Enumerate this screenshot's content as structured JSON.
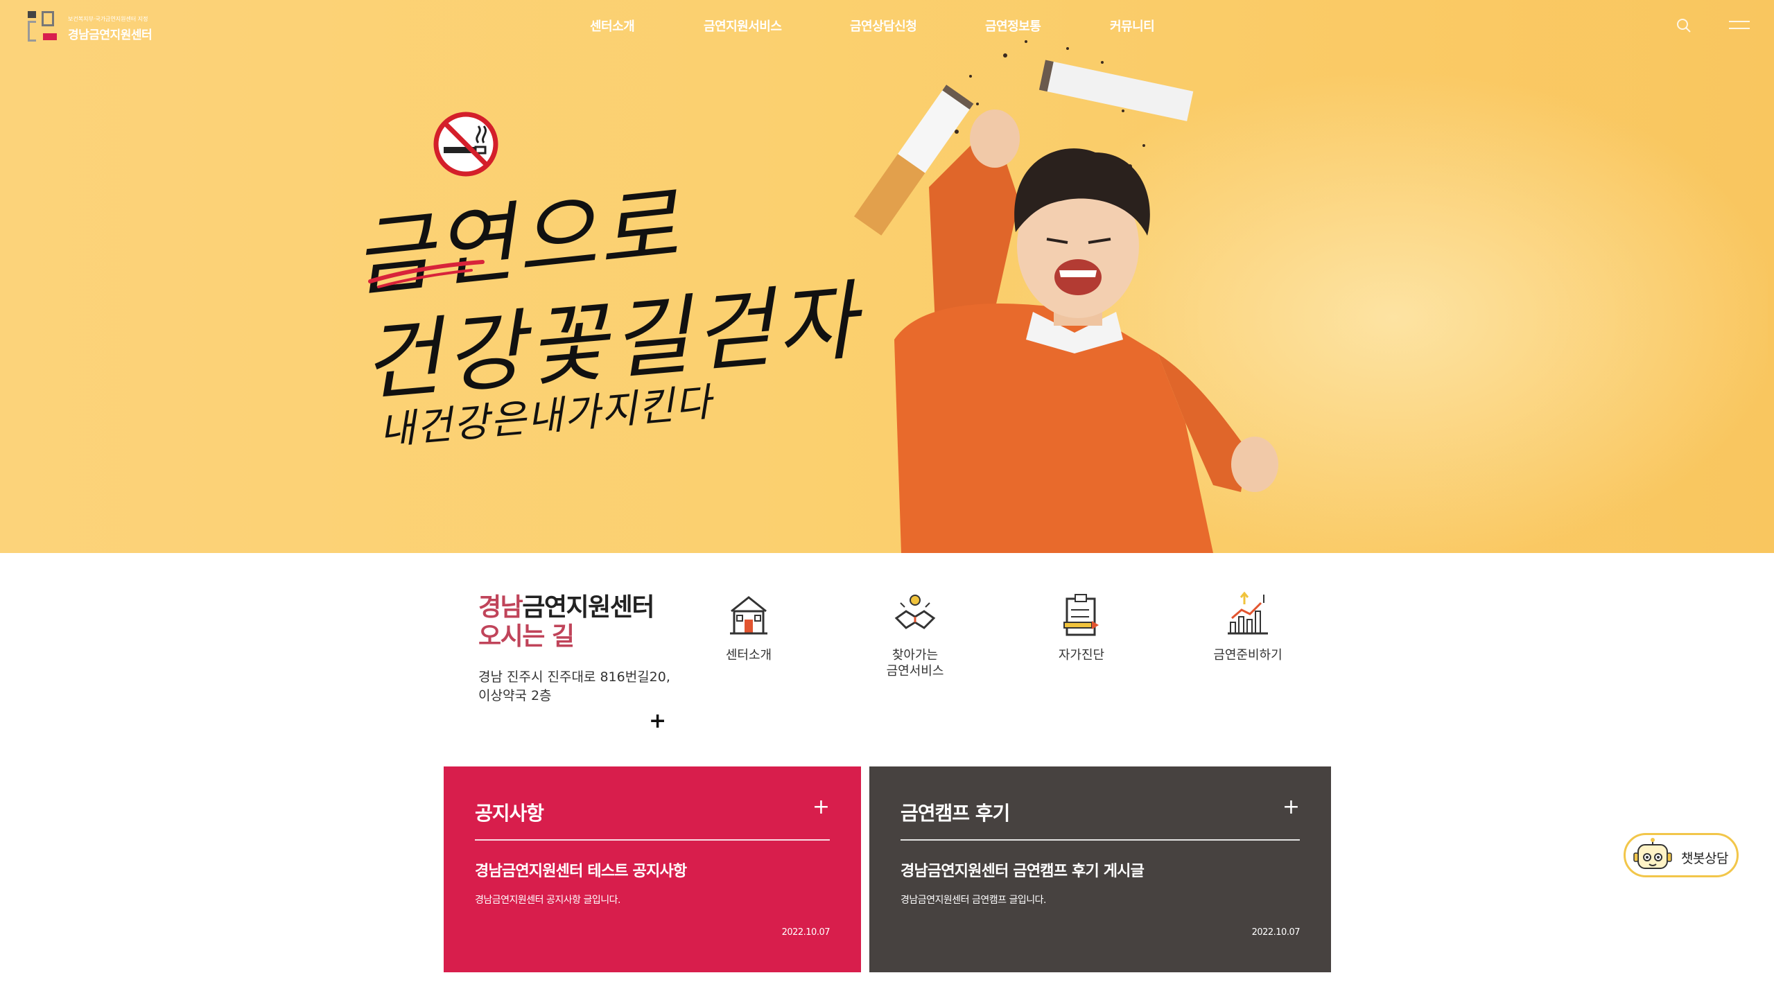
{
  "header": {
    "logo_small": "보건복지부·국가금연지원센터 지정",
    "logo_name": "경남금연지원센터",
    "nav": [
      {
        "label": "센터소개"
      },
      {
        "label": "금연지원서비스"
      },
      {
        "label": "금연상담신청"
      },
      {
        "label": "금연정보통"
      },
      {
        "label": "커뮤니티"
      }
    ],
    "search_icon": "search-icon",
    "menu_icon": "hamburger-menu-icon"
  },
  "hero": {
    "line1": "금연으로",
    "line2": "건강꽃길걷자",
    "line3": "내건강은내가지킨다",
    "no_smoking_icon": "no-smoking-icon",
    "colors": {
      "background": "#fbd06f",
      "accent_red": "#d81e4c"
    }
  },
  "location": {
    "title_red": "경남",
    "title_dark": "금연지원센터",
    "title_line2": "오시는 길",
    "address_line1": "경남 진주시 진주대로 816번길20,",
    "address_line2": "이상약국 2층",
    "plus": "+"
  },
  "quick_links": [
    {
      "label": "센터소개",
      "icon": "building-icon"
    },
    {
      "label": "찾아가는\n금연서비스",
      "icon": "handshake-icon"
    },
    {
      "label": "자가진단",
      "icon": "clipboard-icon"
    },
    {
      "label": "금연준비하기",
      "icon": "growth-chart-icon"
    }
  ],
  "boards": {
    "notice": {
      "title": "공지사항",
      "plus": "+",
      "post_title": "경남금연지원센터 테스트 공지사항",
      "post_desc": "경남금연지원센터 공지사항 글입니다.",
      "date": "2022.10.07",
      "color": "#d81e4c"
    },
    "review": {
      "title": "금연캠프 후기",
      "plus": "+",
      "post_title": "경남금연지원센터 금연캠프 후기 게시글",
      "post_desc": "경남금연지원센터 금연캠프 글입니다.",
      "date": "2022.10.07",
      "color": "#474240"
    }
  },
  "chatbot": {
    "label": "챗봇상담",
    "icon": "robot-icon"
  }
}
